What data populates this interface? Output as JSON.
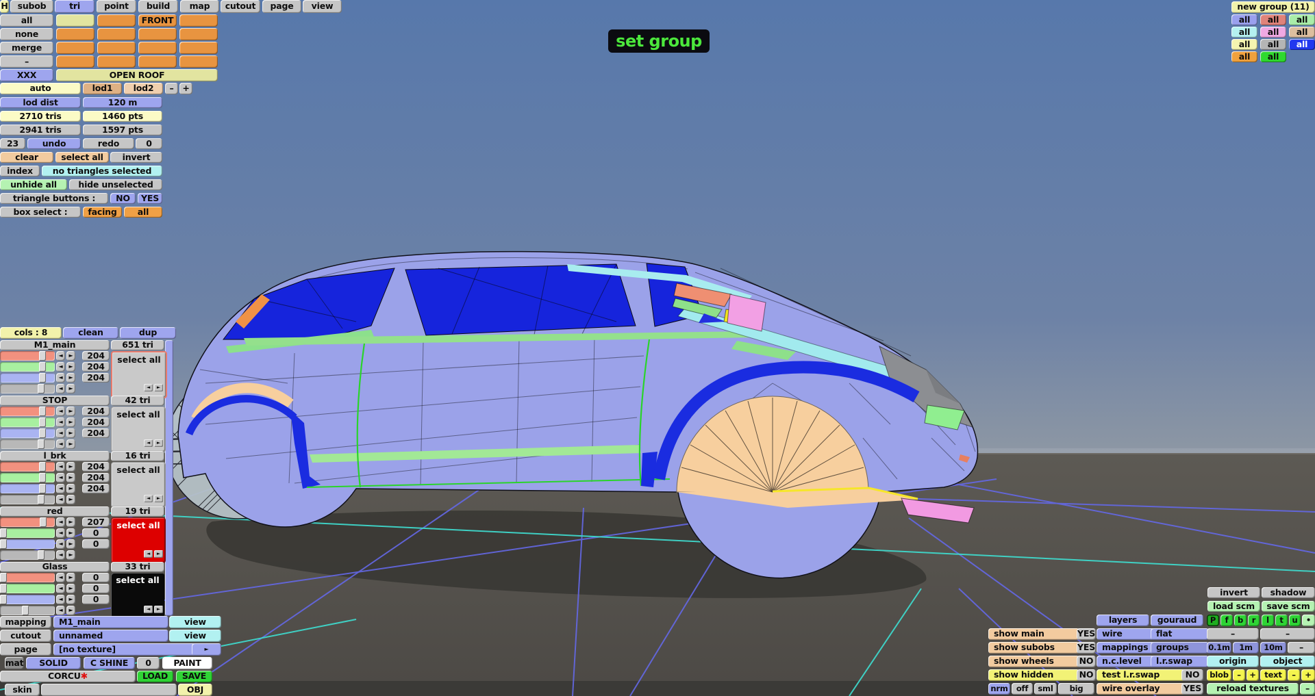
{
  "ui": {
    "arrow_left": "◄",
    "arrow_right": "►",
    "play": "►",
    "dash": "–",
    "plus": "+",
    "dot": "•"
  },
  "menu": {
    "items": [
      "H",
      "subob",
      "tri",
      "point",
      "build",
      "map",
      "cutout",
      "page",
      "view"
    ],
    "active": "tri"
  },
  "subob": {
    "all": "all",
    "none": "none",
    "merge": "merge",
    "dash": "–",
    "xxx": "XXX",
    "front": "FRONT",
    "open_roof": "OPEN ROOF"
  },
  "lod": {
    "auto": "auto",
    "lod1": "lod1",
    "lod2": "lod2",
    "dist_label": "lod dist",
    "dist": "120 m",
    "tris_a": "2710 tris",
    "pts_a": "1460 pts",
    "tris_b": "2941 tris",
    "pts_b": "1597 pts"
  },
  "hist": {
    "undo_count": "23",
    "undo": "undo",
    "redo": "redo",
    "redo_count": "0"
  },
  "sel": {
    "clear": "clear",
    "select_all": "select all",
    "invert": "invert",
    "index": "index",
    "status": "no triangles selected",
    "unhide": "unhide all",
    "hide": "hide unselected",
    "tri_btn": "triangle buttons :",
    "no": "NO",
    "yes": "YES",
    "box": "box select :",
    "facing": "facing",
    "all": "all"
  },
  "tooltip": "set group",
  "groups": {
    "title": "new group (11)",
    "all": "all",
    "colors": [
      "#9aa0ee",
      "#e0837a",
      "#a9eda9",
      "#b5f1f1",
      "#efa9e3",
      "#ddbf9f",
      "#f5f5b0",
      "#b5b5b5",
      "#2138ef",
      "#f0a13d",
      "#2fd92f"
    ]
  },
  "materials": {
    "cols": "cols : 8",
    "clean": "clean",
    "dup": "dup",
    "select_all": "select all",
    "blocks": [
      {
        "name": "M1_main",
        "tri": "651 tri",
        "r": "204",
        "g": "204",
        "b": "204"
      },
      {
        "name": "STOP",
        "tri": "42 tri",
        "r": "204",
        "g": "204",
        "b": "204"
      },
      {
        "name": "l_brk",
        "tri": "16 tri",
        "r": "204",
        "g": "204",
        "b": "204"
      },
      {
        "name": "red",
        "tri": "19 tri",
        "r": "207",
        "g": "0",
        "b": "0"
      },
      {
        "name": "Glass",
        "tri": "33 tri",
        "r": "0",
        "g": "0",
        "b": "0"
      }
    ]
  },
  "bl": {
    "mapping": "mapping",
    "mapping_val": "M1_main",
    "view": "view",
    "cutout": "cutout",
    "cutout_val": "unnamed",
    "page": "page",
    "page_val": "[no texture]",
    "mat": "mat",
    "solid": "SOLID",
    "cshine": "C SHINE",
    "zero": "0",
    "paint": "PAINT",
    "corcu": "CORCU",
    "corcu_star": "✱",
    "load": "LOAD",
    "save": "SAVE",
    "skin": "skin",
    "obj": "OBJ"
  },
  "vp": {
    "invert": "invert",
    "shadow": "shadow",
    "load_scm": "load scm",
    "save_scm": "save scm",
    "proj": [
      "P",
      "f",
      "b",
      "r",
      "l",
      "t",
      "u",
      "•"
    ],
    "layers": "layers",
    "gouraud": "gouraud",
    "wire": "wire",
    "flat": "flat",
    "mappings": "mappings",
    "groups": "groups",
    "ncl": "n.c.level",
    "lrs": "l.r.swap",
    "m01": "0.1m",
    "m1": "1m",
    "m10": "10m",
    "origin": "origin",
    "object": "object",
    "show_main": "show main",
    "show_subobs": "show subobs",
    "show_wheels": "show wheels",
    "show_hidden": "show hidden",
    "yes": "YES",
    "no": "NO",
    "test_lrs": "test l.r.swap",
    "blob": "blob",
    "text": "text",
    "nrm": "nrm",
    "off": "off",
    "sml": "sml",
    "big": "big",
    "wire_overlay": "wire overlay",
    "reload": "reload textures"
  },
  "colors": {
    "sky_top": "#5778ab",
    "sky_horizon": "#8d97a4",
    "ground": "#54514c",
    "ground_dark": "#3b3a37",
    "grid_line": "#6468e6",
    "grid_cyan": "#3fd8cb",
    "car_body": "#9ba2e9",
    "glass": "#1624dc",
    "trim_green": "#2ad42a",
    "arch_peach": "#f7cf9e",
    "wheel_mesh": "#b7c3c9",
    "flap_pink": "#f29ae2",
    "stripe_blue": "#1a2ce0",
    "tooltip_green": "#4ce83c",
    "select_red": "#dd0000",
    "select_black": "#0a0a0a"
  }
}
